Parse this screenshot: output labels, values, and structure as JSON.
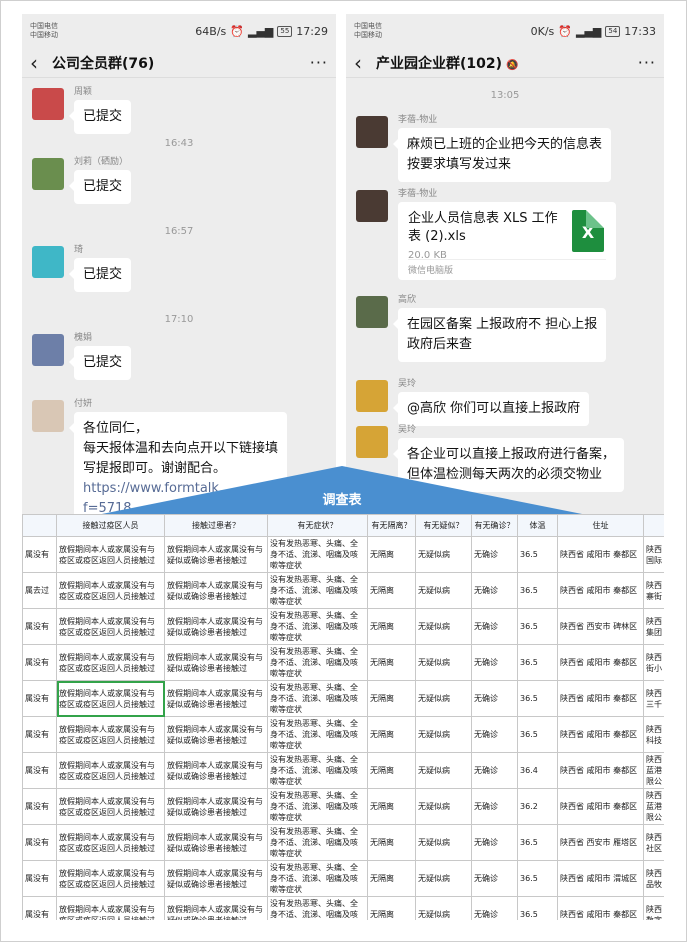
{
  "left": {
    "status": {
      "carrier1": "中国电信",
      "carrier2": "中国移动",
      "speed": "64B/s",
      "battery": "55",
      "time": "17:29"
    },
    "title": "公司全员群(76)",
    "messages": [
      {
        "type": "msg",
        "name": "周颖",
        "text": "已提交"
      },
      {
        "type": "time",
        "text": "16:43"
      },
      {
        "type": "msg",
        "name": "刘莉（硒励）",
        "text": "已提交"
      },
      {
        "type": "time",
        "text": "16:57"
      },
      {
        "type": "msg",
        "name": "琦",
        "text": "已提交"
      },
      {
        "type": "time",
        "text": "17:10"
      },
      {
        "type": "msg",
        "name": "槐娟",
        "text": "已提交"
      },
      {
        "type": "msg",
        "name": "付妍",
        "lines": [
          "各位同仁，",
          "每天报体温和去向点开以下链接填",
          "写提报即可。谢谢配合。",
          "https://www.formtalk.",
          "f=5718"
        ]
      }
    ]
  },
  "right": {
    "status": {
      "carrier1": "中国电信",
      "carrier2": "中国移动",
      "speed": "0K/s",
      "battery": "54",
      "time": "17:33"
    },
    "title": "产业园企业群(102)",
    "messages": [
      {
        "type": "time",
        "text": "13:05"
      },
      {
        "type": "msg",
        "name": "李蓓-物业",
        "lines": [
          "麻烦已上班的企业把今天的信息表",
          "按要求填写发过来"
        ]
      },
      {
        "type": "file",
        "name": "李蓓-物业",
        "filename": "企业人员信息表 XLS 工作表 (2).xls",
        "size": "20.0 KB",
        "source": "微信电脑版",
        "icon_letter": "X"
      },
      {
        "type": "msg",
        "name": "高欣",
        "lines": [
          "在园区备案  上报政府不  担心上报",
          "政府后来查"
        ]
      },
      {
        "type": "msg",
        "name": "吴玲",
        "lines": [
          "@高欣  你们可以直接上报政府"
        ]
      },
      {
        "type": "msg",
        "name": "吴玲",
        "lines": [
          "各企业可以直接上报政府进行备案，",
          "但体温检测每天两次的必须交物业"
        ]
      }
    ]
  },
  "overlay": {
    "label": "调查表",
    "accent": "#4a8fd0"
  },
  "table": {
    "headers": [
      "",
      "接触过疫区人员",
      "接触过患者？",
      "有无症状？",
      "有无隔离？",
      "有无疑似？",
      "有无确诊？",
      "体温",
      "住址",
      ""
    ],
    "rows": [
      [
        "属没有",
        "放假期间本人或家属没有与疫区或疫区返回人员接触过",
        "放假期间本人或家属没有与疑似或确诊患者接触过",
        "没有发热恶寒、头痛、全身不适、流涕、咽痛及咳嗽等症状",
        "无隔离",
        "无疑似病",
        "无确诊",
        "36.5",
        "陕西省  咸阳市  秦都区",
        "陕西国际"
      ],
      [
        "属去过",
        "放假期间本人或家属没有与疫区或疫区返回人员接触过",
        "放假期间本人或家属没有与疑似或确诊患者接触过",
        "没有发热恶寒、头痛、全身不适、流涕、咽痛及咳嗽等症状",
        "无隔离",
        "无疑似病",
        "无确诊",
        "36.5",
        "陕西省  咸阳市  秦都区",
        "陕西寨街"
      ],
      [
        "属没有",
        "放假期间本人或家属没有与疫区或疫区返回人员接触过",
        "放假期间本人或家属没有与疑似或确诊患者接触过",
        "没有发热恶寒、头痛、全身不适、流涕、咽痛及咳嗽等症状",
        "无隔离",
        "无疑似病",
        "无确诊",
        "36.5",
        "陕西省  西安市  碑林区",
        "陕西集团"
      ],
      [
        "属没有",
        "放假期间本人或家属没有与疫区或疫区返回人员接触过",
        "放假期间本人或家属没有与疑似或确诊患者接触过",
        "没有发热恶寒、头痛、全身不适、流涕、咽痛及咳嗽等症状",
        "无隔离",
        "无疑似病",
        "无确诊",
        "36.5",
        "陕西省  咸阳市  秦都区",
        "陕西街小"
      ],
      [
        "属没有",
        "放假期间本人或家属没有与疫区或疫区返回人员接触过",
        "放假期间本人或家属没有与疑似或确诊患者接触过",
        "没有发热恶寒、头痛、全身不适、流涕、咽痛及咳嗽等症状",
        "无隔离",
        "无疑似病",
        "无确诊",
        "36.5",
        "陕西省  咸阳市  秦都区",
        "陕西三千"
      ],
      [
        "属没有",
        "放假期间本人或家属没有与疫区或疫区返回人员接触过",
        "放假期间本人或家属没有与疑似或确诊患者接触过",
        "没有发热恶寒、头痛、全身不适、流涕、咽痛及咳嗽等症状",
        "无隔离",
        "无疑似病",
        "无确诊",
        "36.5",
        "陕西省  咸阳市  秦都区",
        "陕西科技"
      ],
      [
        "属没有",
        "放假期间本人或家属没有与疫区或疫区返回人员接触过",
        "放假期间本人或家属没有与疑似或确诊患者接触过",
        "没有发热恶寒、头痛、全身不适、流涕、咽痛及咳嗽等症状",
        "无隔离",
        "无疑似病",
        "无确诊",
        "36.4",
        "陕西省  咸阳市  秦都区",
        "陕西蓝港限公"
      ],
      [
        "属没有",
        "放假期间本人或家属没有与疫区或疫区返回人员接触过",
        "放假期间本人或家属没有与疑似或确诊患者接触过",
        "没有发热恶寒、头痛、全身不适、流涕、咽痛及咳嗽等症状",
        "无隔离",
        "无疑似病",
        "无确诊",
        "36.2",
        "陕西省  咸阳市  秦都区",
        "陕西蓝港限公"
      ],
      [
        "属没有",
        "放假期间本人或家属没有与疫区或疫区返回人员接触过",
        "放假期间本人或家属没有与疑似或确诊患者接触过",
        "没有发热恶寒、头痛、全身不适、流涕、咽痛及咳嗽等症状",
        "无隔离",
        "无疑似病",
        "无确诊",
        "36.5",
        "陕西省  西安市  雁塔区",
        "陕西社区"
      ],
      [
        "属没有",
        "放假期间本人或家属没有与疫区或疫区返回人员接触过",
        "放假期间本人或家属没有与疑似或确诊患者接触过",
        "没有发热恶寒、头痛、全身不适、流涕、咽痛及咳嗽等症状",
        "无隔离",
        "无疑似病",
        "无确诊",
        "36.5",
        "陕西省  咸阳市  渭城区",
        "陕西品牧"
      ],
      [
        "属没有",
        "放假期间本人或家属没有与疫区或疫区返回人员接触过",
        "放假期间本人或家属没有与疑似或确诊患者接触过",
        "没有发热恶寒、头痛、全身不适、流涕、咽痛及咳嗽等症状",
        "无隔离",
        "无疑似病",
        "无确诊",
        "36.5",
        "陕西省  咸阳市  秦都区",
        "陕西数字"
      ]
    ]
  }
}
